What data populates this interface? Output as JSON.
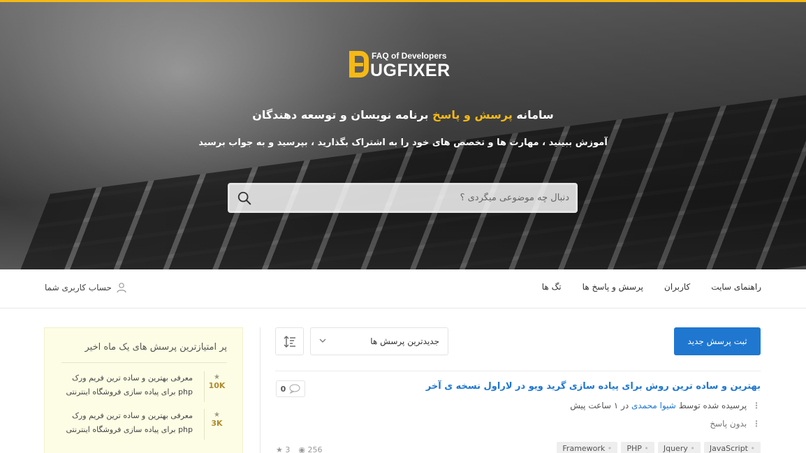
{
  "hero": {
    "logo_tag": "FAQ of Developers",
    "logo_name": "UGFIXER",
    "tagline_pre": "سامانه",
    "tagline_highlight": "پرسش و پاسخ",
    "tagline_post": "برنامه نویسان و توسعه دهندگان",
    "subline": "آموزش ببینید ، مهارت ها و تخصص های خود را به اشتراک بگذارید ، بپرسید و به جواب برسید",
    "search_placeholder": "دنبال چه موضوعی میگردی ؟"
  },
  "nav": {
    "items": [
      "تگ ها",
      "پرسش و پاسخ ها",
      "کاربران",
      "راهنمای سایت"
    ],
    "account": "حساب کاربری شما"
  },
  "sidebar": {
    "title": "پر امتیازترین پرسش های یک ماه اخیر",
    "items": [
      {
        "score": "10K",
        "text": "معرفی بهترین و ساده ترین فریم ورک php برای پیاده سازی فروشگاه اینترنتی"
      },
      {
        "score": "3K",
        "text": "معرفی بهترین و ساده ترین فریم ورک php برای پیاده سازی فروشگاه اینترنتی"
      }
    ]
  },
  "toolbar": {
    "ask_label": "ثبت پرسش جدید",
    "sort_value": "جدیدترین پرسش ها"
  },
  "question": {
    "title": "بهترین و ساده ترین روش برای پیاده سازی گرید ویو در لاراول نسخه ی آخر",
    "asked_prefix": "پرسیده شده توسط",
    "author": "شیوا محمدی",
    "asked_suffix": "در ۱ ساعت پیش",
    "status": "بدون پاسخ",
    "answers": "0",
    "votes": "3",
    "views": "256",
    "tags": [
      "JavaScript",
      "Jquery",
      "PHP",
      "Framework"
    ]
  },
  "colors": {
    "accent": "#f5b916",
    "primary": "#1f77d0"
  }
}
